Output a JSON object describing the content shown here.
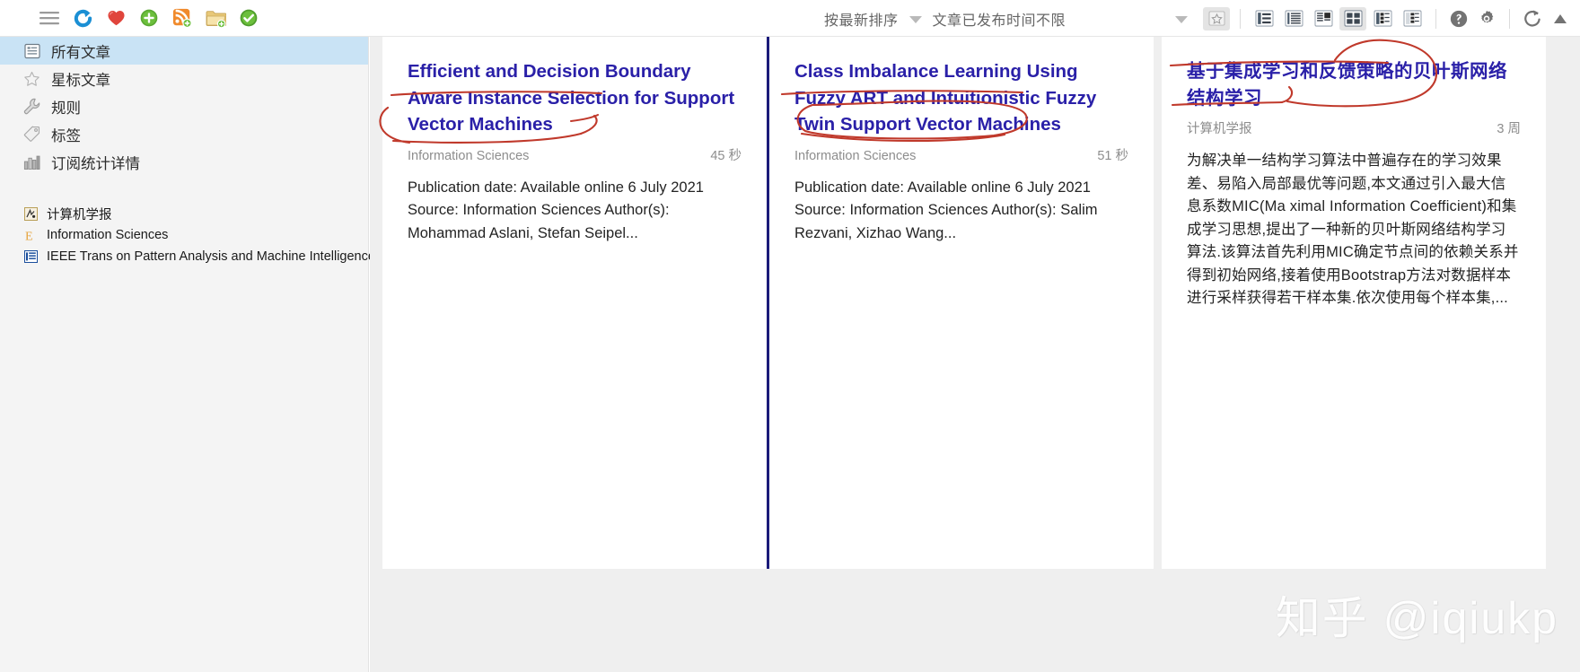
{
  "toolbar": {
    "left_icons": [
      {
        "name": "hamburger-menu-icon",
        "label": "菜单"
      },
      {
        "name": "refresh-feeds-icon",
        "label": "刷新"
      },
      {
        "name": "favorite-heart-icon",
        "label": "收藏"
      },
      {
        "name": "add-icon",
        "label": "添加"
      },
      {
        "name": "add-rss-feed-icon",
        "label": "添加订阅"
      },
      {
        "name": "add-folder-icon",
        "label": "新建文件夹"
      },
      {
        "name": "mark-read-check-icon",
        "label": "标记已读"
      }
    ],
    "sort_label": "按最新排序",
    "filter_label": "文章已发布时间不限",
    "star_filter_icon": "star-filter-icon",
    "view_modes": [
      {
        "name": "view-list",
        "label": "列表视图",
        "active": false
      },
      {
        "name": "view-compact",
        "label": "紧凑视图",
        "active": false
      },
      {
        "name": "view-magazine",
        "label": "杂志视图",
        "active": false
      },
      {
        "name": "view-card",
        "label": "卡片视图",
        "active": true
      },
      {
        "name": "view-grid",
        "label": "网格视图",
        "active": false
      },
      {
        "name": "view-split",
        "label": "分栏视图",
        "active": false
      }
    ],
    "help_label": "帮助",
    "settings_label": "设置",
    "sync_label": "同步"
  },
  "sidebar": {
    "items": [
      {
        "label": "所有文章",
        "icon": "all-articles-icon",
        "selected": true
      },
      {
        "label": "星标文章",
        "icon": "star-icon",
        "selected": false
      },
      {
        "label": "规则",
        "icon": "wrench-icon",
        "selected": false
      },
      {
        "label": "标签",
        "icon": "tag-icon",
        "selected": false
      },
      {
        "label": "订阅统计详情",
        "icon": "bar-chart-icon",
        "selected": false
      }
    ],
    "feeds": [
      {
        "label": "计算机学报",
        "icon": "feed-favicon-jisuanji"
      },
      {
        "label": "Information Sciences",
        "icon": "feed-favicon-elsevier"
      },
      {
        "label": "IEEE Trans on Pattern Analysis and Machine Intelligence",
        "icon": "feed-favicon-ieee"
      }
    ]
  },
  "articles": [
    {
      "title": "Efficient and Decision Boundary Aware Instance Selection for Support Vector Machines",
      "source": "Information Sciences",
      "time": "45 秒",
      "body": "Publication date: Available online 6 July 2021 Source: Information Sciences Author(s): Mohammad Aslani, Stefan Seipel..."
    },
    {
      "title": "Class Imbalance Learning Using Fuzzy ART and Intuitionistic Fuzzy Twin Support Vector Machines",
      "source": "Information Sciences",
      "time": "51 秒",
      "body": "Publication date: Available online 6 July 2021 Source: Information Sciences Author(s): Salim Rezvani, Xizhao Wang..."
    },
    {
      "title": "基于集成学习和反馈策略的贝叶斯网络结构学习",
      "source": "计算机学报",
      "time": "3 周",
      "body": "为解决单一结构学习算法中普遍存在的学习效果差、易陷入局部最优等问题,本文通过引入最大信息系数MIC(Ma ximal Information Coefficient)和集成学习思想,提出了一种新的贝叶斯网络结构学习算法.该算法首先利用MIC确定节点间的依赖关系并得到初始网络,接着使用Bootstrap方法对数据样本进行采样获得若干样本集.依次使用每个样本集,..."
    }
  ],
  "watermark": "知乎 @iqiukp",
  "colors": {
    "title_blue": "#2a20a8",
    "annotation_red": "#c0392b",
    "selection_blue": "#c9e3f5",
    "background_gray": "#efefef",
    "divider_navy": "#1b1b7a"
  }
}
